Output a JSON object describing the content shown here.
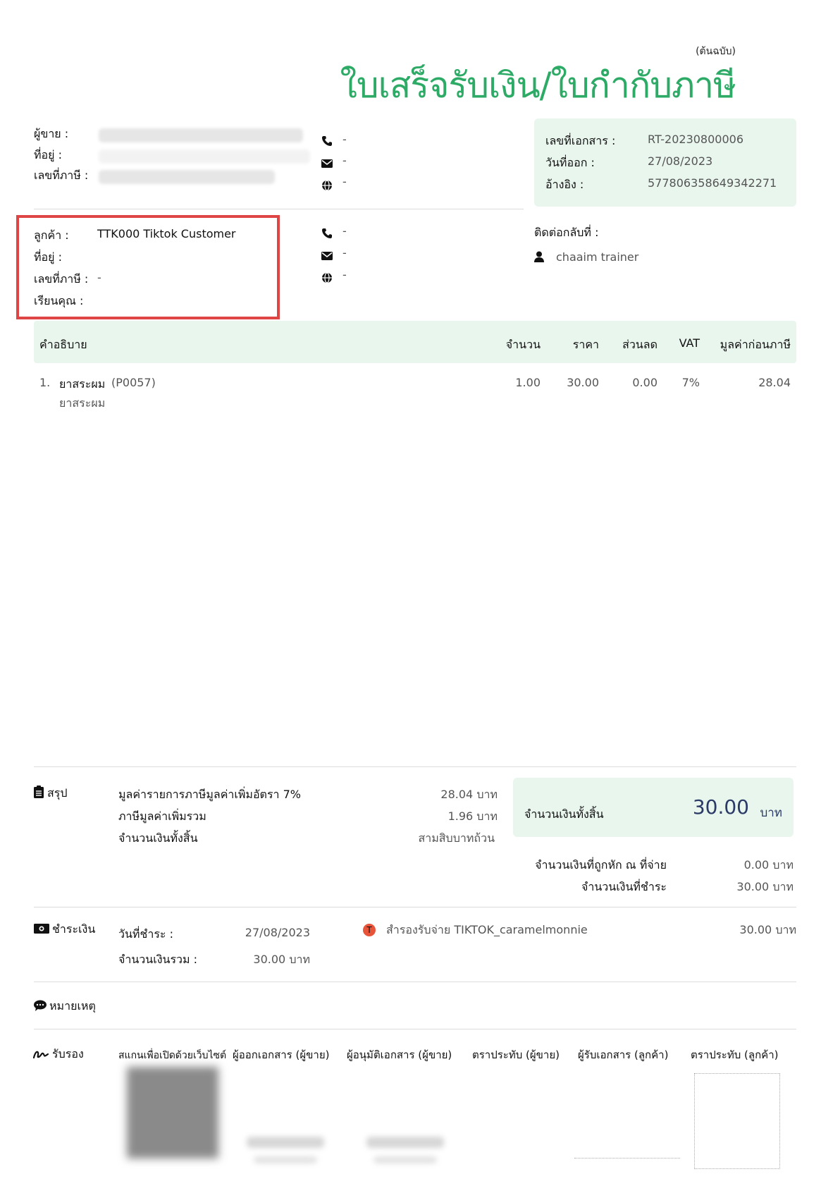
{
  "header": {
    "copy_label": "(ต้นฉบับ)",
    "title": "ใบเสร็จรับเงิน/ใบกำกับภาษี"
  },
  "seller": {
    "seller_label": "ผู้ขาย :",
    "address_label": "ที่อยู่ :",
    "taxid_label": "เลขที่ภาษี :",
    "phone": "-",
    "email": "-",
    "web": "-"
  },
  "doc_info": {
    "doc_no_label": "เลขที่เอกสาร :",
    "doc_no": "RT-20230800006",
    "issue_date_label": "วันที่ออก :",
    "issue_date": "27/08/2023",
    "ref_label": "อ้างอิง :",
    "ref": "577806358649342271"
  },
  "customer": {
    "customer_label": "ลูกค้า :",
    "customer_value": "TTK000 Tiktok Customer",
    "address_label": "ที่อยู่ :",
    "taxid_label": "เลขที่ภาษี :",
    "taxid_value": "-",
    "attn_label": "เรียนคุณ :",
    "phone": "-",
    "email": "-",
    "web": "-"
  },
  "contact": {
    "label": "ติดต่อกลับที่ :",
    "name": "chaaim trainer"
  },
  "items_table": {
    "headers": {
      "description": "คำอธิบาย",
      "qty": "จำนวน",
      "price": "ราคา",
      "discount": "ส่วนลด",
      "vat": "VAT",
      "pretax": "มูลค่าก่อนภาษี"
    },
    "rows": [
      {
        "index": "1.",
        "name": "ยาสระผม",
        "code": "(P0057)",
        "subtitle": "ยาสระผม",
        "qty": "1.00",
        "price": "30.00",
        "discount": "0.00",
        "vat": "7%",
        "pretax": "28.04"
      }
    ]
  },
  "summary": {
    "section_label": "สรุป",
    "vat_base_label": "มูลค่ารายการภาษีมูลค่าเพิ่มอัตรา 7%",
    "vat_base_value": "28.04 บาท",
    "vat_total_label": "ภาษีมูลค่าเพิ่มรวม",
    "vat_total_value": "1.96 บาท",
    "grand_total_label": "จำนวนเงินทั้งสิ้น",
    "grand_total_words": "สามสิบบาทถ้วน",
    "total_box_label": "จำนวนเงินทั้งสิ้น",
    "total_box_value": "30.00",
    "total_box_unit": "บาท",
    "withheld_label": "จำนวนเงินที่ถูกหัก ณ ที่จ่าย",
    "withheld_value": "0.00 บาท",
    "paid_label": "จำนวนเงินที่ชำระ",
    "paid_value": "30.00 บาท"
  },
  "payment": {
    "section_label": "ชำระเงิน",
    "date_label": "วันที่ชำระ :",
    "date_value": "27/08/2023",
    "total_label": "จำนวนเงินรวม :",
    "total_value": "30.00 บาท",
    "channel_badge": "T",
    "channel_text": "สำรองรับจ่าย TIKTOK_caramelmonnie",
    "channel_amount": "30.00 บาท"
  },
  "notes": {
    "section_label": "หมายเหตุ"
  },
  "signatures": {
    "section_label": "รับรอง",
    "scan_label": "สแกนเพื่อเปิดด้วยเว็บไซต์",
    "issuer_label": "ผู้ออกเอกสาร (ผู้ขาย)",
    "approver_label": "ผู้อนุมัติเอกสาร (ผู้ขาย)",
    "seller_stamp_label": "ตราประทับ (ผู้ขาย)",
    "receiver_label": "ผู้รับเอกสาร (ลูกค้า)",
    "customer_stamp_label": "ตราประทับ (ลูกค้า)"
  },
  "colors": {
    "title_green": "#2dab66",
    "box_green": "#e9f6ee",
    "highlight_red": "#e04545",
    "total_navy": "#2b3a67",
    "badge_orange": "#e8543a"
  }
}
